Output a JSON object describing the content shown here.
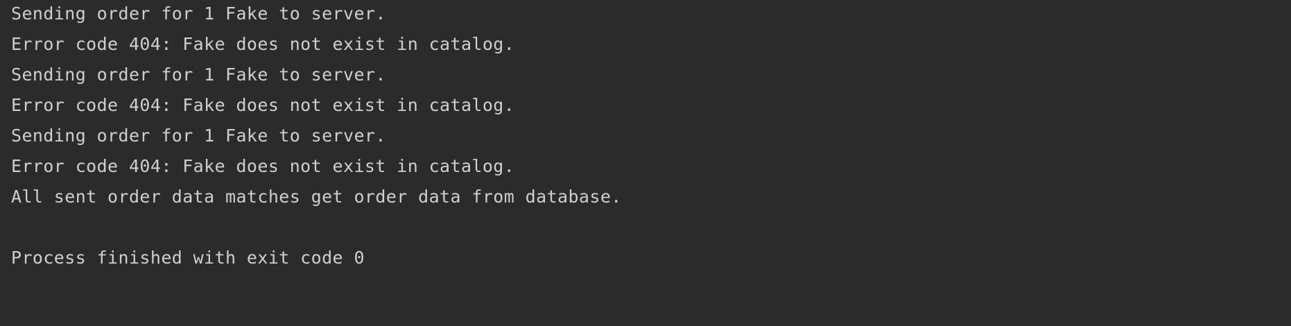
{
  "console": {
    "lines": [
      "Sending order for 1 Fake to server.",
      "Error code 404: Fake does not exist in catalog.",
      "Sending order for 1 Fake to server.",
      "Error code 404: Fake does not exist in catalog.",
      "Sending order for 1 Fake to server.",
      "Error code 404: Fake does not exist in catalog.",
      "All sent order data matches get order data from database.",
      "",
      "Process finished with exit code 0"
    ]
  },
  "colors": {
    "background": "#2b2b2b",
    "text": "#cfcfcf"
  }
}
